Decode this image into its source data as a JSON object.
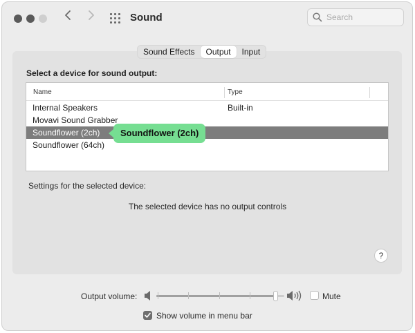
{
  "window": {
    "title": "Sound"
  },
  "search": {
    "placeholder": "Search"
  },
  "tabs": [
    {
      "label": "Sound Effects",
      "active": false
    },
    {
      "label": "Output",
      "active": true
    },
    {
      "label": "Input",
      "active": false
    }
  ],
  "output": {
    "heading": "Select a device for sound output:",
    "columns": {
      "name": "Name",
      "type": "Type"
    },
    "devices": [
      {
        "name": "Internal Speakers",
        "type": "Built-in"
      },
      {
        "name": "Movavi Sound Grabber",
        "type": ""
      },
      {
        "name": "Soundflower (2ch)",
        "type": "",
        "selected": true
      },
      {
        "name": "Soundflower (64ch)",
        "type": ""
      }
    ],
    "callout": "Soundflower (2ch)",
    "settings_label": "Settings for the selected device:",
    "no_controls_message": "The selected device has no output controls",
    "help": "?"
  },
  "volume": {
    "label": "Output volume:",
    "level": 0.95,
    "mute_label": "Mute",
    "mute_checked": false,
    "menu_bar_label": "Show volume in menu bar",
    "menu_bar_checked": true
  },
  "colors": {
    "selection": "#7d7d7d",
    "callout": "#76de92"
  }
}
